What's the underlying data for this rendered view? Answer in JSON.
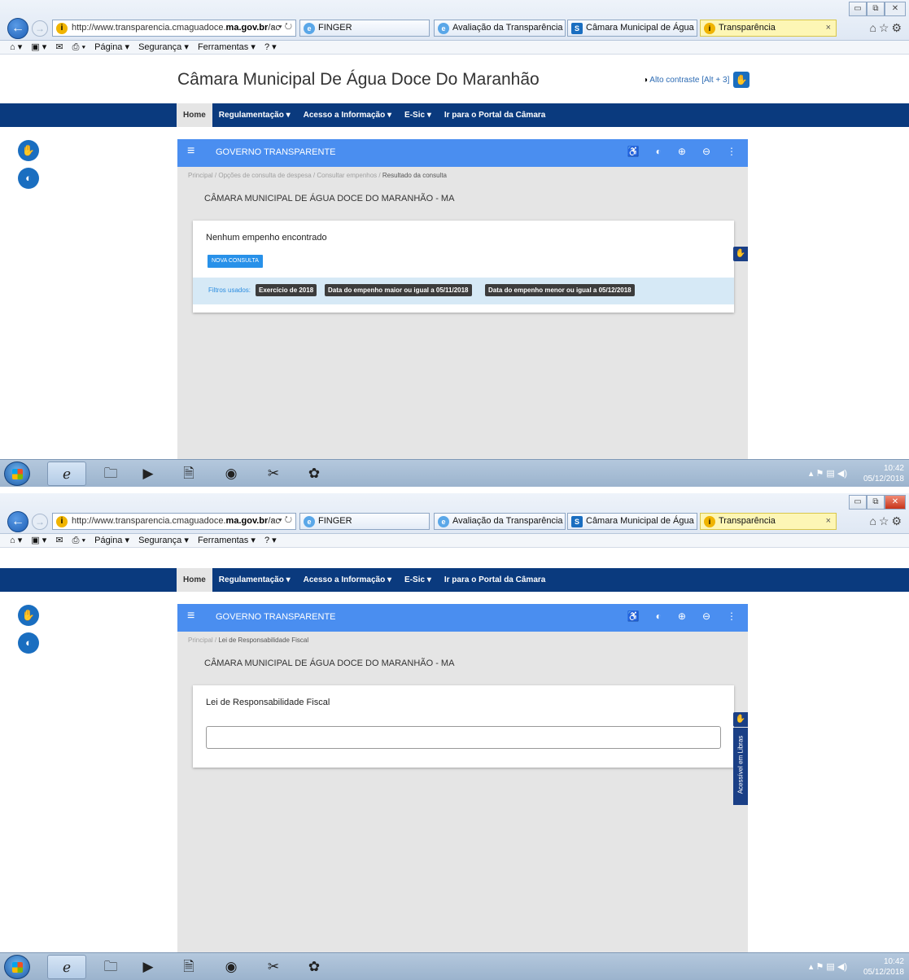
{
  "browser": {
    "url_prefix": "http://www.transparencia.cmaguadoce.",
    "url_domain": "ma.gov.br",
    "url_suffix": "/ac",
    "addr_tools": "⌕ ▾ ↻",
    "tabs": [
      {
        "label": "FINGER"
      },
      {
        "label": "Avaliação da Transparência do..."
      },
      {
        "label": "Câmara Municipal de Água D..."
      },
      {
        "label": "Transparência"
      }
    ],
    "tab_close": "×",
    "command_bar": [
      "Página ▾",
      "Segurança ▾",
      "Ferramentas ▾"
    ]
  },
  "site": {
    "title": "Câmara Municipal De Água Doce Do Maranhão",
    "contrast_link": "Alto contraste [Alt + 3]",
    "nav": [
      "Home",
      "Regulamentação ▾",
      "Acesso a Informação ▾",
      "E-Sic ▾",
      "Ir para o Portal da Câmara"
    ]
  },
  "app": {
    "header_title": "GOVERNO TRANSPARENTE",
    "org_name": "CÂMARA MUNICIPAL DE ÁGUA DOCE DO MARANHÃO - MA"
  },
  "screen1": {
    "breadcrumb": [
      "Principal",
      "Opções de consulta de despesa",
      "Consultar empenhos",
      "Resultado da consulta"
    ],
    "result_title": "Nenhum empenho encontrado",
    "new_query_button": "NOVA CONSULTA",
    "filters_label": "Filtros usados:",
    "filters": [
      "Exercício de 2018",
      "Data do empenho maior ou igual a 05/11/2018",
      "Data do empenho menor ou igual a 05/12/2018"
    ],
    "clock_time": "10:42",
    "clock_date": "05/12/2018"
  },
  "screen2": {
    "breadcrumb": [
      "Principal",
      "Lei de Responsabilidade Fiscal"
    ],
    "card_title": "Lei de Responsabilidade Fiscal",
    "libras_tab": "Acessível em Libras",
    "clock_time": "10:42",
    "clock_date": "05/12/2018"
  },
  "colors": {
    "nav_blue": "#0a3a7e",
    "header_blue": "#4a8ef0",
    "button_blue": "#2891e9",
    "chip_dark": "#3c3c3c"
  }
}
